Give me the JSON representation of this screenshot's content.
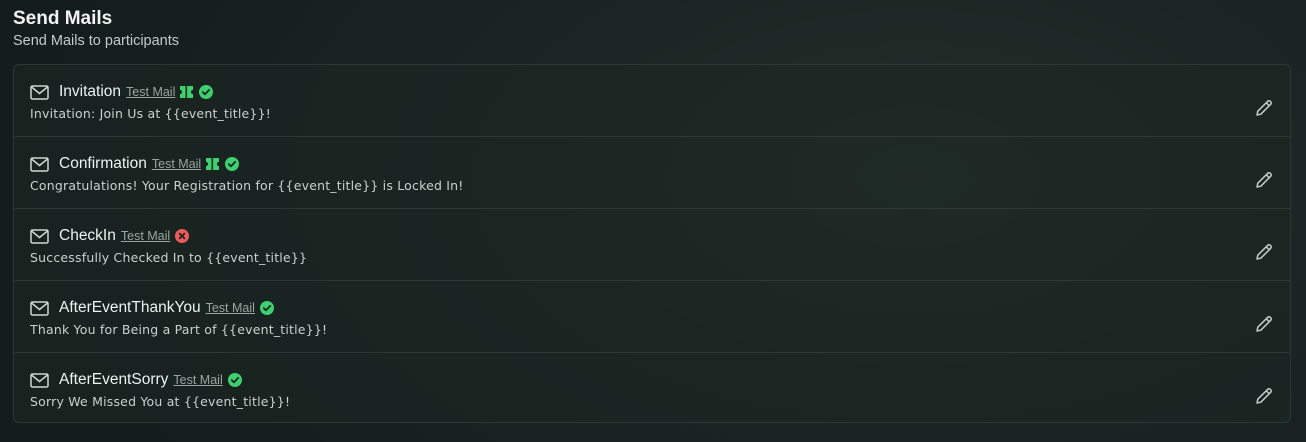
{
  "header": {
    "title": "Send Mails",
    "subtitle": "Send Mails to participants"
  },
  "test_mail_label": "Test Mail",
  "colors": {
    "success": "#3ecf6e",
    "error": "#ef5a5a",
    "ticket": "#3ecf6e"
  },
  "mails": [
    {
      "name": "Invitation",
      "subject": "Invitation: Join Us at {{event_title}}!",
      "icons": [
        "mail-icon",
        "ticket-icon",
        "check-circle-icon",
        "pencil-icon"
      ],
      "status": "success"
    },
    {
      "name": "Confirmation",
      "subject": "Congratulations! Your Registration for {{event_title}} is Locked In!",
      "icons": [
        "mail-icon",
        "ticket-icon",
        "check-circle-icon",
        "pencil-icon"
      ],
      "status": "success"
    },
    {
      "name": "CheckIn",
      "subject": "Successfully Checked In to {{event_title}}",
      "icons": [
        "mail-icon",
        "x-circle-icon",
        "pencil-icon"
      ],
      "status": "error"
    },
    {
      "name": "AfterEventThankYou",
      "subject": "Thank You for Being a Part of {{event_title}}!",
      "icons": [
        "mail-icon",
        "check-circle-icon",
        "pencil-icon"
      ],
      "status": "success"
    },
    {
      "name": "AfterEventSorry",
      "subject": "Sorry We Missed You at {{event_title}}!",
      "icons": [
        "mail-icon",
        "check-circle-icon",
        "pencil-icon"
      ],
      "status": "success"
    }
  ]
}
